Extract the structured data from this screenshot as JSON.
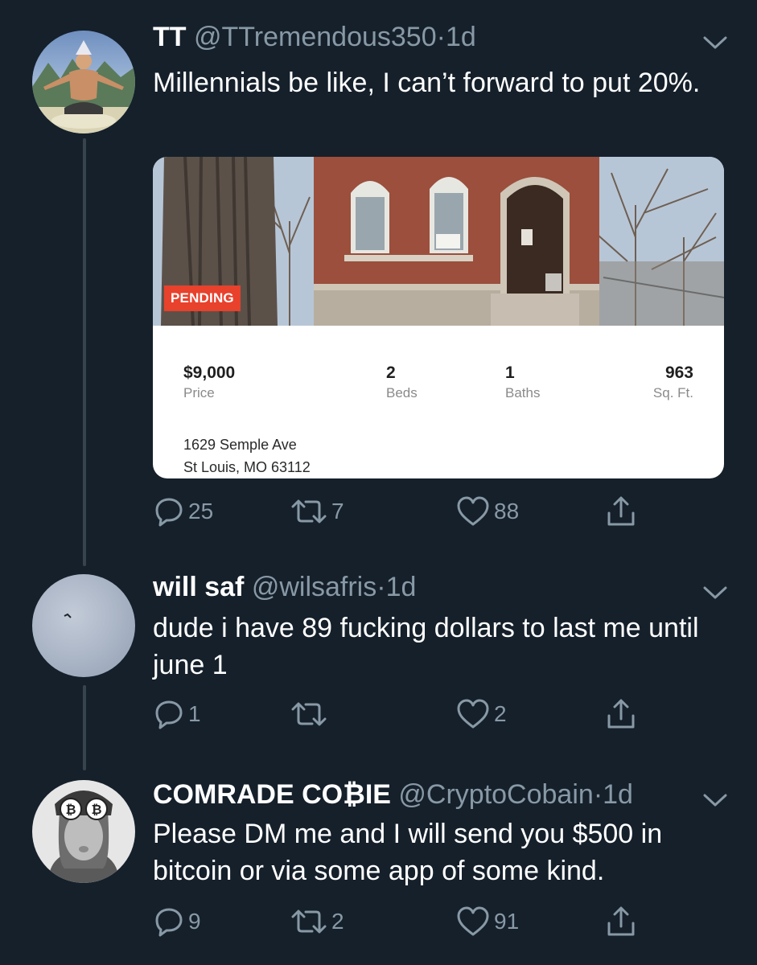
{
  "tweets": [
    {
      "name": "TT",
      "handle": "@TTremendous350",
      "time": "1d",
      "text": "Millennials be like, I can’t forward to put 20%.",
      "listing": {
        "badge": "PENDING",
        "price": "$9,000",
        "price_label": "Price",
        "beds": "2",
        "beds_label": "Beds",
        "baths": "1",
        "baths_label": "Baths",
        "sqft": "963",
        "sqft_label": "Sq. Ft.",
        "address_line1": "1629 Semple Ave",
        "address_line2": "St Louis, MO 63112"
      },
      "replies": "25",
      "retweets": "7",
      "likes": "88"
    },
    {
      "name": "will saf",
      "handle": "@wilsafris",
      "time": "1d",
      "text": "dude i have 89 fucking dollars to last me until june 1",
      "replies": "1",
      "retweets": "",
      "likes": "2"
    },
    {
      "name": "COMRADE CO₿IE",
      "handle": "@CryptoCobain",
      "time": "1d",
      "text": "Please DM me and I will send you $500 in bitcoin or via some app of some kind.",
      "replies": "9",
      "retweets": "2",
      "likes": "91"
    }
  ],
  "separator": "·",
  "colors": {
    "background": "#15202b",
    "secondary_text": "#8899a6",
    "pending_badge": "#e8412c",
    "thread_line": "#38444d"
  },
  "icons": [
    "reply-icon",
    "retweet-icon",
    "like-icon",
    "share-icon",
    "chevron-down-icon"
  ]
}
